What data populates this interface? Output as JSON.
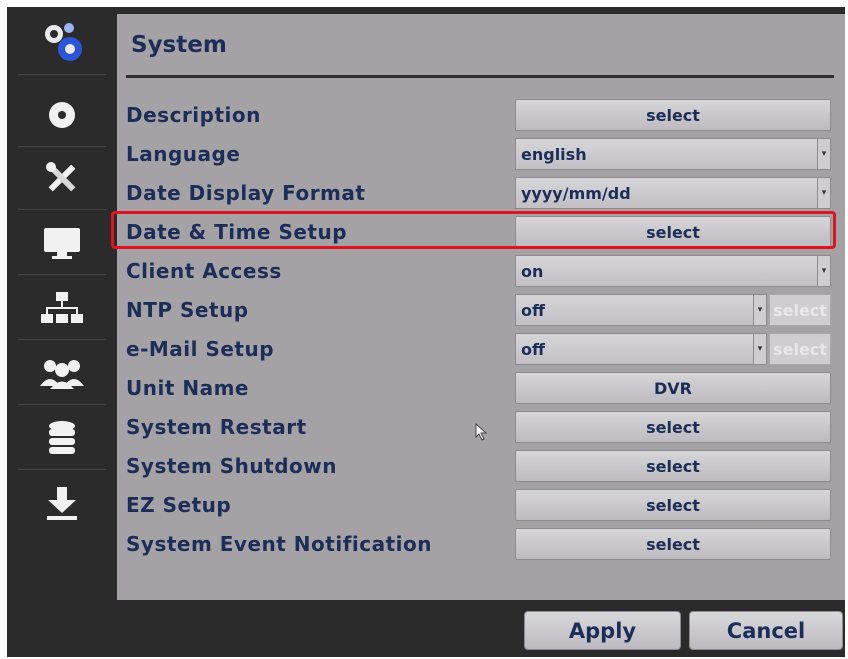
{
  "panel": {
    "title": "System"
  },
  "sidebar": {
    "items": [
      {
        "icon": "gears-icon",
        "active": true
      },
      {
        "icon": "disc-icon"
      },
      {
        "icon": "tools-icon"
      },
      {
        "icon": "monitor-icon"
      },
      {
        "icon": "network-icon"
      },
      {
        "icon": "users-icon"
      },
      {
        "icon": "database-icon"
      },
      {
        "icon": "download-icon"
      }
    ]
  },
  "rows": [
    {
      "label": "Description",
      "control": "button",
      "value": "select"
    },
    {
      "label": "Language",
      "control": "dropdown",
      "value": "english"
    },
    {
      "label": "Date Display Format",
      "control": "dropdown",
      "value": "yyyy/mm/dd"
    },
    {
      "label": "Date & Time Setup",
      "control": "button",
      "value": "select",
      "highlighted": true
    },
    {
      "label": "Client Access",
      "control": "dropdown",
      "value": "on"
    },
    {
      "label": "NTP Setup",
      "control": "dropdown+button",
      "value": "off",
      "button": "select",
      "button_disabled": true
    },
    {
      "label": "e-Mail Setup",
      "control": "dropdown+button",
      "value": "off",
      "button": "select",
      "button_disabled": true
    },
    {
      "label": "Unit Name",
      "control": "button",
      "value": "DVR"
    },
    {
      "label": "System Restart",
      "control": "button",
      "value": "select"
    },
    {
      "label": "System Shutdown",
      "control": "button",
      "value": "select"
    },
    {
      "label": "EZ Setup",
      "control": "button",
      "value": "select"
    },
    {
      "label": "System Event Notification",
      "control": "button",
      "value": "select"
    }
  ],
  "footer": {
    "apply_label": "Apply",
    "cancel_label": "Cancel"
  },
  "colors": {
    "highlight": "#e0141e",
    "text": "#1c2e57",
    "panel": "#a5a2a6",
    "frame": "#2b2b2b"
  }
}
